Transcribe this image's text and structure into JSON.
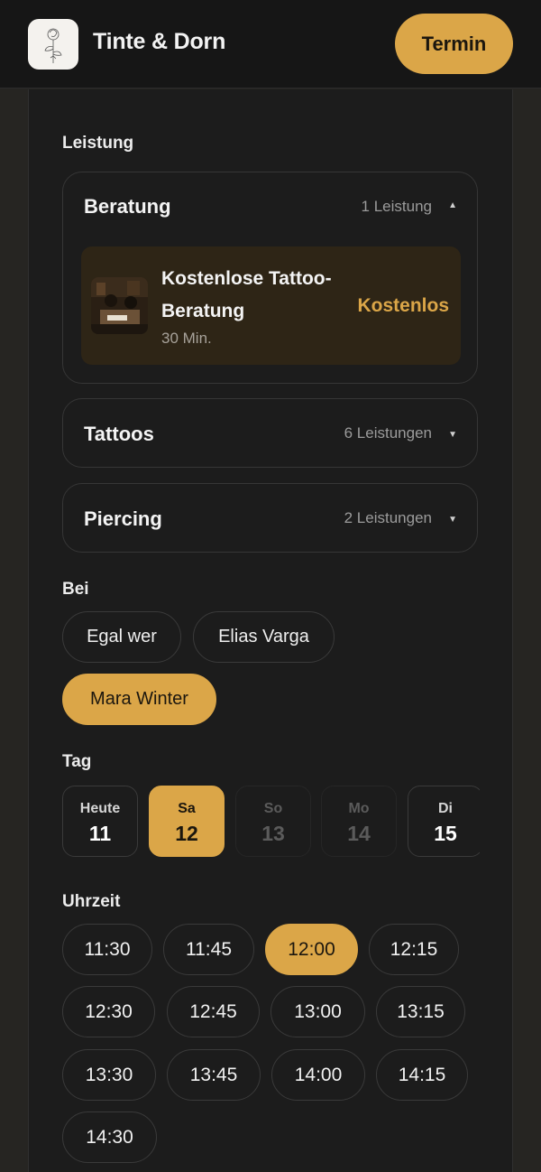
{
  "header": {
    "brand": "Tinte & Dorn",
    "logo_icon": "rose-line-art-icon",
    "cta_label": "Termin"
  },
  "service_section": {
    "label": "Leistung",
    "categories": [
      {
        "title": "Beratung",
        "count": "1 Leistung",
        "expanded": true,
        "services": [
          {
            "name": "Kostenlose Tattoo-Beratung",
            "duration": "30 Min.",
            "price": "Kostenlos"
          }
        ]
      },
      {
        "title": "Tattoos",
        "count": "6 Leistungen",
        "expanded": false
      },
      {
        "title": "Piercing",
        "count": "2 Leistungen",
        "expanded": false
      }
    ]
  },
  "staff_section": {
    "label": "Bei",
    "options": [
      "Egal wer",
      "Elias Varga",
      "Mara Winter"
    ],
    "selected": "Mara Winter"
  },
  "day_section": {
    "label": "Tag",
    "days": [
      {
        "name": "Heute",
        "date": "11",
        "state": "available"
      },
      {
        "name": "Sa",
        "date": "12",
        "state": "selected"
      },
      {
        "name": "So",
        "date": "13",
        "state": "disabled"
      },
      {
        "name": "Mo",
        "date": "14",
        "state": "disabled"
      },
      {
        "name": "Di",
        "date": "15",
        "state": "available"
      }
    ]
  },
  "time_section": {
    "label": "Uhrzeit",
    "slots": [
      "11:30",
      "11:45",
      "12:00",
      "12:15",
      "12:30",
      "12:45",
      "13:00",
      "13:15",
      "13:30",
      "13:45",
      "14:00",
      "14:15",
      "14:30"
    ],
    "selected": "12:00"
  },
  "colors": {
    "accent": "#dba648",
    "background": "#1c1c1c",
    "header": "#161616",
    "service_highlight": "#2e2516"
  }
}
